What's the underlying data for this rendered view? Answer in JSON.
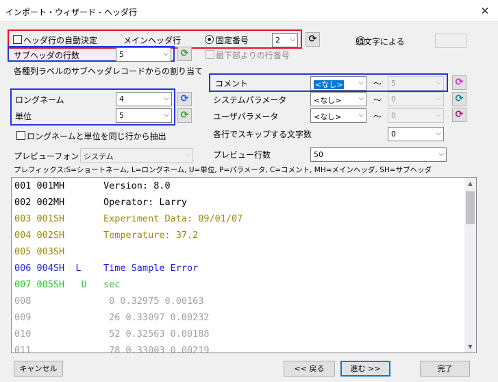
{
  "window": {
    "title": "インポート・ウィザード - ヘッダ行",
    "close_glyph": "✕"
  },
  "auto_header": {
    "label": "ヘッダ行の自動決定",
    "checked": false
  },
  "main_header": {
    "label": "メインヘッダ行",
    "fixed_label": "固定番号",
    "fixed_value": "2",
    "by_prefix_label": "頭文字による",
    "from_bottom_label": "最下部よりの行番号"
  },
  "sub_header": {
    "label": "サブヘッダの行数",
    "value": "5"
  },
  "assign": {
    "group_label": "各種列ラベルのサブヘッダレコードからの割り当て",
    "long_name": {
      "label": "ロングネーム",
      "value": "4"
    },
    "unit": {
      "label": "単位",
      "value": "5"
    },
    "comment": {
      "label": "コメント",
      "value": "<なし>",
      "to_value": "5"
    },
    "system_param": {
      "label": "システムパラメータ",
      "value": "<なし>",
      "to_value": "0"
    },
    "user_param": {
      "label": "ユーザパラメータ",
      "value": "<なし>",
      "to_value": "0"
    },
    "tilde": "～",
    "same_row_label": "ロングネームと単位を同じ行から抽出",
    "skip_chars_label": "各行でスキップする文字数",
    "skip_chars_value": "0"
  },
  "preview_settings": {
    "font_label": "プレビューフォント",
    "font_value": "システム",
    "rows_label": "プレビュー行数",
    "rows_value": "50",
    "prefix_legend": "プレフィックス:S=ショートネーム, L=ロングネーム, U=単位, P=パラメータ, C=コメント, MH=メインヘッダ, SH=サブヘッダ"
  },
  "preview_lines": [
    {
      "text": "001 001MH       Version: 8.0",
      "color": "#000000"
    },
    {
      "text": "002 002MH       Operator: Larry",
      "color": "#000000"
    },
    {
      "text": "003 001SH       Experiment Data: 09/01/07",
      "color": "#9a8a00"
    },
    {
      "text": "004 002SH       Temperature: 37.2",
      "color": "#9a8a00"
    },
    {
      "text": "005 003SH",
      "color": "#9a8a00"
    },
    {
      "text": "006 004SH  L    Time Sample Error",
      "color": "#1a1ae6"
    },
    {
      "text": "007 005SH   U   sec",
      "color": "#22cc22"
    },
    {
      "text": "008              0 0.32975 0.00163",
      "color": "#a0a0a0"
    },
    {
      "text": "009              26 0.33097 0.00232",
      "color": "#a0a0a0"
    },
    {
      "text": "010              52 0.32563 0.00188",
      "color": "#a0a0a0"
    },
    {
      "text": "011              78 0.33003 0.00219",
      "color": "#a0a0a0"
    }
  ],
  "buttons": {
    "cancel": "キャンセル",
    "back": "<< 戻る",
    "next": "進む >>",
    "finish": "完了"
  },
  "icons": {
    "refresh_blue": "refresh-blue-icon",
    "refresh_green": "refresh-green-icon",
    "refresh_magenta": "refresh-magenta-icon",
    "refresh_teal": "refresh-teal-icon",
    "refresh_black": "refresh-black-icon"
  },
  "colors": {
    "highlight_red": "#e81123",
    "highlight_blue": "#2233dd",
    "selection": "#0078d7"
  }
}
